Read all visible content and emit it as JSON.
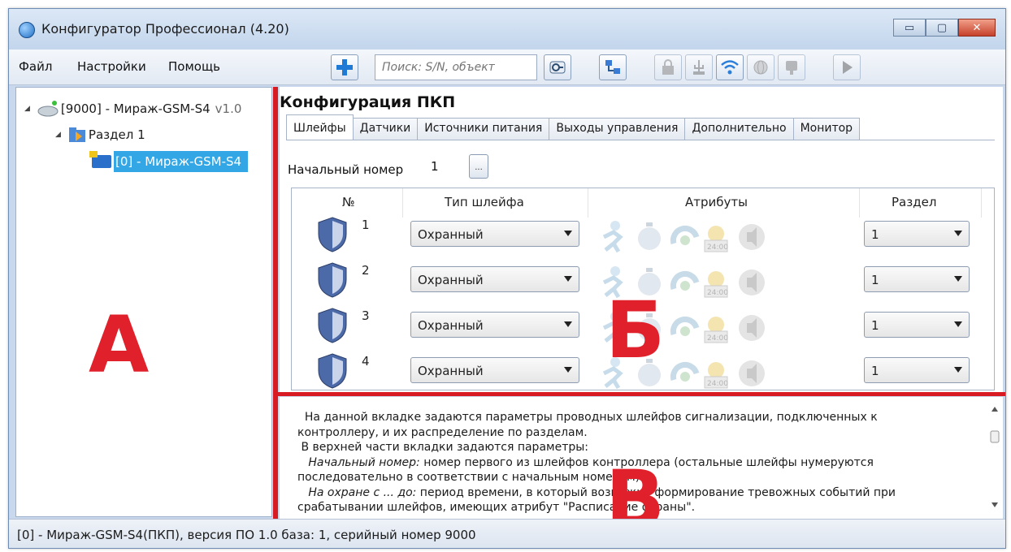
{
  "window": {
    "title": "Конфигуратор Профессионал (4.20)",
    "buttons": {
      "minimize": "▭",
      "maximize": "▢",
      "close": "✕"
    }
  },
  "menu": {
    "items": [
      "Файл",
      "Настройки",
      "Помощь"
    ]
  },
  "toolbar": {
    "search_placeholder": "Поиск: S/N, объект",
    "buttons": [
      "add-icon",
      "connect-icon",
      "device-tree-icon",
      "lock-icon",
      "usb-icon",
      "wifi-icon",
      "globe-icon",
      "modem-icon",
      "play-icon"
    ]
  },
  "tree": {
    "device": "[9000] - Мираж-GSM-S4",
    "device_version": "v1.0",
    "partition": "Раздел 1",
    "panel": "[0] - Мираж-GSM-S4"
  },
  "annotations": {
    "a": "А",
    "b": "Б",
    "v": "В"
  },
  "config": {
    "title": "Конфигурация ПКП",
    "tabs": [
      "Шлейфы",
      "Датчики",
      "Источники питания",
      "Выходы управления",
      "Дополнительно",
      "Монитор"
    ],
    "active_tab": "Шлейфы",
    "start_number_label": "Начальный номер",
    "start_number": "1",
    "ellipsis": "...",
    "columns": [
      "№",
      "Тип шлейфа",
      "Атрибуты",
      "Раздел"
    ],
    "rows": [
      {
        "num": "1",
        "type": "Охранный",
        "partition": "1"
      },
      {
        "num": "2",
        "type": "Охранный",
        "partition": "1"
      },
      {
        "num": "3",
        "type": "Охранный",
        "partition": "1"
      },
      {
        "num": "4",
        "type": "Охранный",
        "partition": "1"
      }
    ],
    "attribute_icons": [
      "walk-icon",
      "timer-icon",
      "auto-rearm-icon",
      "schedule-icon",
      "sound-off-icon"
    ],
    "clock_label": "24:00"
  },
  "description": {
    "l1": "На данной вкладке задаются параметры проводных шлейфов сигнализации, подключенных к",
    "l2": "контроллеру, и их распределение по разделам.",
    "l3": "В верхней части вкладки задаются параметры:",
    "l4_em": "Начальный номер:",
    "l4": " номер первого из шлейфов контроллера (остальные шлейфы нумеруются",
    "l5": "последовательно в соответствии с начальным номером).",
    "l6_em": "На охране с ... до:",
    "l6": " период времени, в который возможно формирование тревожных событий при",
    "l7": "срабатывании шлейфов, имеющих атрибут \"Расписание охраны\"."
  },
  "status": {
    "text": "[0] - Мираж-GSM-S4(ПКП), версия ПО 1.0 база: 1, серийный номер 9000"
  },
  "colors": {
    "accent_red": "#d81b22",
    "selection": "#33a6e6"
  }
}
